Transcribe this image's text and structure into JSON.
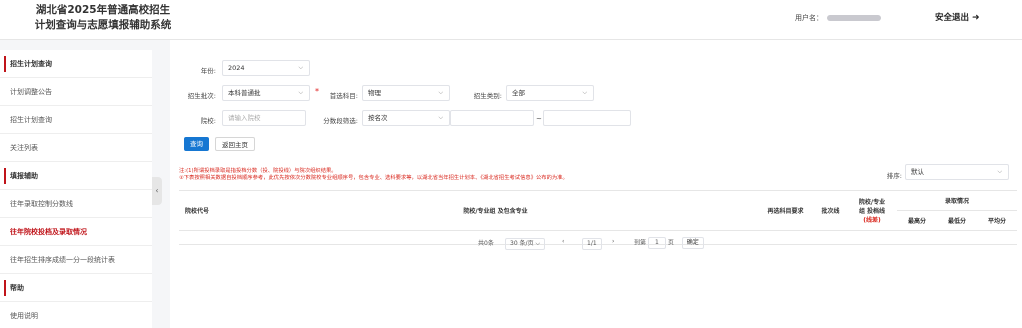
{
  "header": {
    "title_line1": "湖北省2025年普通高校招生",
    "title_line2": "计划查询与志愿填报辅助系统",
    "user_label": "用户名：",
    "logout_label": "安全退出"
  },
  "sidebar": {
    "items": [
      {
        "label": "招生计划查询",
        "kind": "head"
      },
      {
        "label": "计划调整公告",
        "kind": "item"
      },
      {
        "label": "招生计划查询",
        "kind": "item"
      },
      {
        "label": "关注列表",
        "kind": "item"
      },
      {
        "label": "填报辅助",
        "kind": "head"
      },
      {
        "label": "往年录取控制分数线",
        "kind": "item"
      },
      {
        "label": "往年院校投档及录取情况",
        "kind": "active"
      },
      {
        "label": "往年招生排序成绩一分一段统计表",
        "kind": "item"
      },
      {
        "label": "帮助",
        "kind": "head"
      },
      {
        "label": "使用说明",
        "kind": "item"
      }
    ],
    "collapse_glyph": "‹"
  },
  "form": {
    "year_label": "年份:",
    "year_value": "2024",
    "batch_label": "招生批次:",
    "batch_value": "本科普通批",
    "required_mark": "*",
    "subject_label": "首选科目:",
    "subject_value": "物理",
    "category_label": "招生类别:",
    "category_value": "全部",
    "school_label": "院校:",
    "school_placeholder": "请输入院校",
    "score_filter_label": "分数段筛选:",
    "score_filter_value": "按名次",
    "range_sep": "~",
    "query_button": "查询",
    "home_button": "返回主页"
  },
  "notes": {
    "line1": "注:(1)所谓投档录取是指投档分数（投、院投线）与院次组织结果。",
    "line2": "②下表按照相关数据自投档顺序参考，此优先按依次分数院校专业组顺序号，包含专业、选科要求等，以湖北省当年招生计划本、《湖北省招生考试信息》公布的为准。"
  },
  "sort": {
    "label": "排序:",
    "value": "默认"
  },
  "table": {
    "col_code": "院校代号",
    "col_group": "院校/专业组 及包含专业",
    "col_subject_req": "再选科目要求",
    "col_batch": "批次线",
    "col_line_a": "院校/专业",
    "col_line_b": "组 投档线",
    "col_line_c": "(线差)",
    "col_admission": "录取情况",
    "col_max": "最高分",
    "col_min": "最低分",
    "col_avg": "平均分"
  },
  "pagination": {
    "total": "共0条",
    "per_page": "30 条/页",
    "page": "1/1",
    "goto_label": "到第",
    "goto_value": "1",
    "page_unit": "页",
    "confirm": "确定"
  },
  "colors": {
    "accent_red": "#c0141a",
    "primary_blue": "#1677d2",
    "note_red": "#d9261c"
  }
}
